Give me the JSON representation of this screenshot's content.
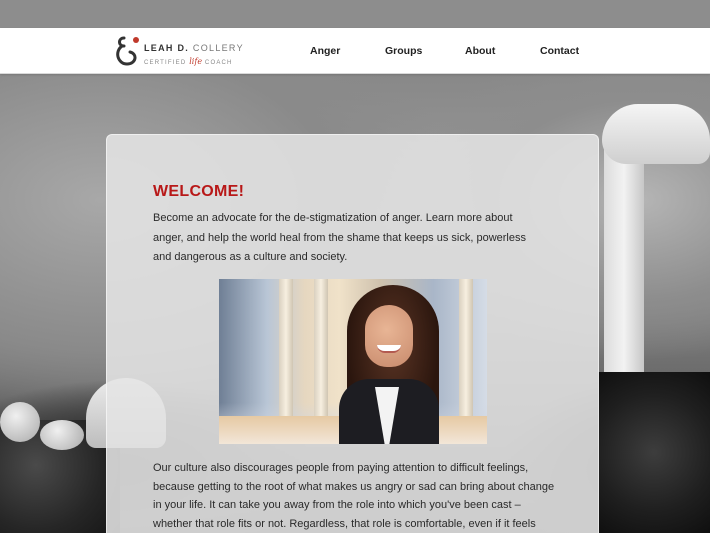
{
  "logo": {
    "name_bold": "LEAH D.",
    "name_light": "COLLERY",
    "sub_left": "CERTIFIED",
    "sub_script": "life",
    "sub_right": "COACH"
  },
  "nav": {
    "items": [
      "Anger",
      "Groups",
      "About",
      "Contact"
    ]
  },
  "content": {
    "heading": "WELCOME!",
    "intro": "Become an advocate for the de-stigmatization of anger. Learn more about anger, and help the world heal from the shame that keeps us sick, powerless and dangerous as a culture and society.",
    "body": "Our culture also discourages people from paying attention to difficult feelings, because getting to the root of what makes us angry or sad can bring about change in your life. It can take you away from the role into which you've been cast – whether that role fits or not. Regardless, that role is comfortable, even if it feels"
  },
  "colors": {
    "accent": "#b81818",
    "header_bg": "#ffffff",
    "text": "#2a2a2a"
  }
}
